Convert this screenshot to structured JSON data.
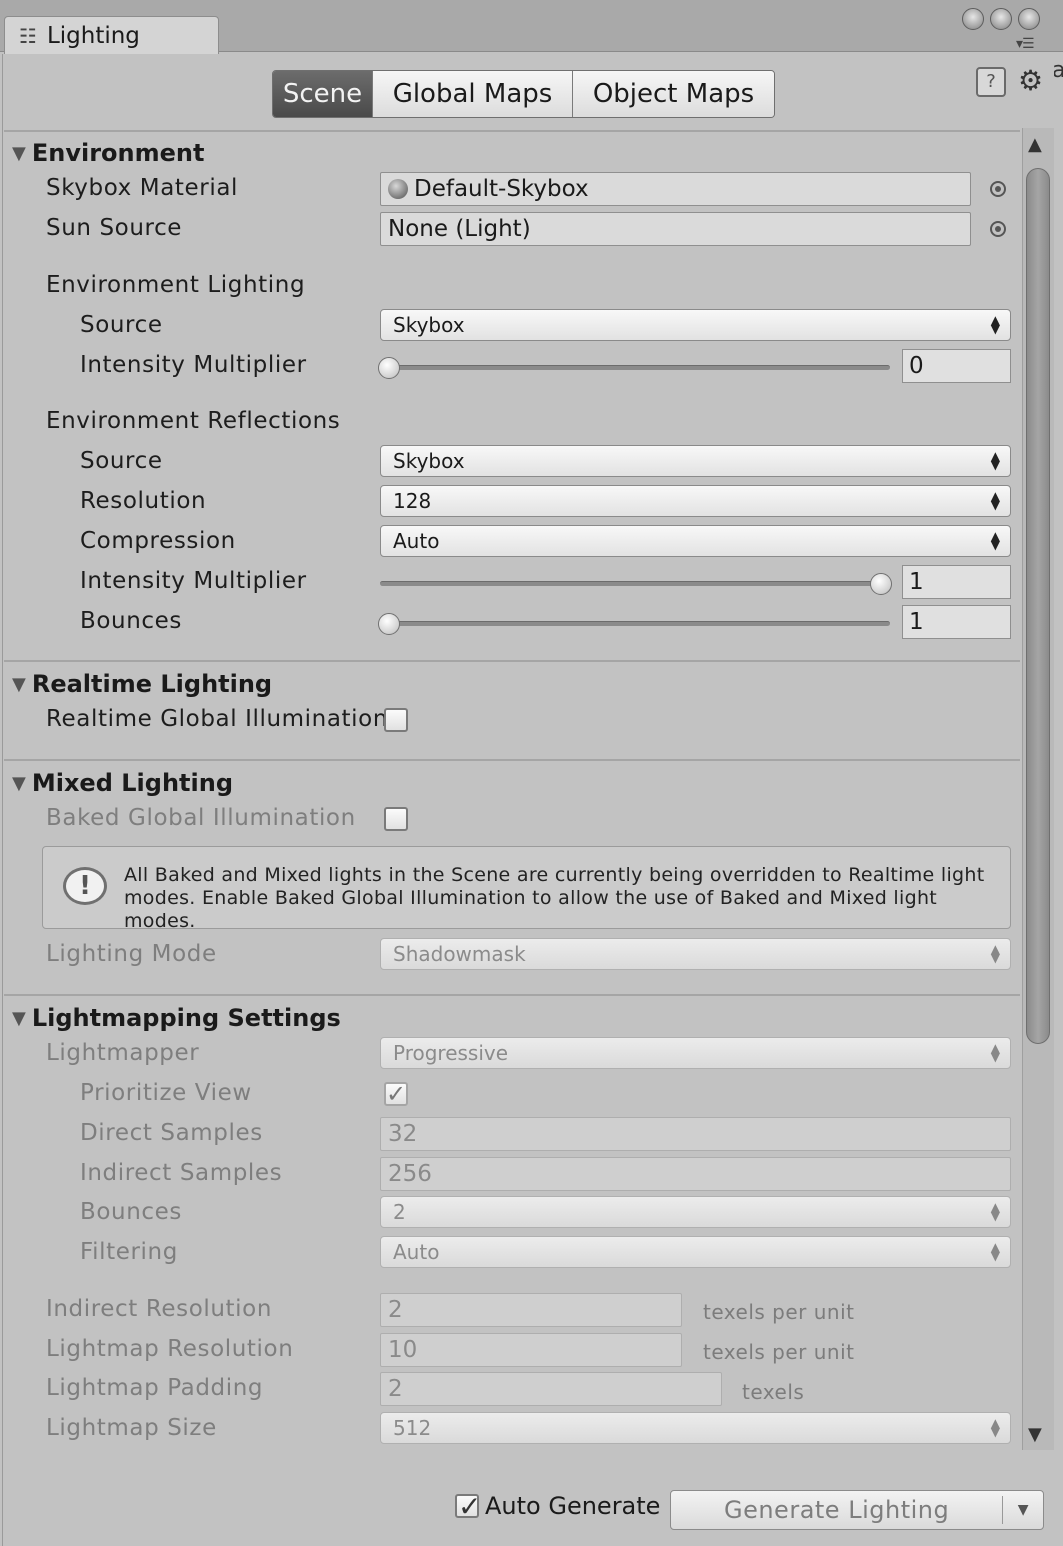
{
  "window": {
    "tab_title": "Lighting",
    "tab_icon": "sliders-icon"
  },
  "tabs": [
    {
      "label": "Scene",
      "active": true
    },
    {
      "label": "Global Maps",
      "active": false
    },
    {
      "label": "Object Maps",
      "active": false
    }
  ],
  "environment": {
    "title": "Environment",
    "skybox_material": {
      "label": "Skybox Material",
      "value": "Default-Skybox"
    },
    "sun_source": {
      "label": "Sun Source",
      "value": "None (Light)"
    },
    "env_lighting": {
      "label": "Environment Lighting",
      "source": {
        "label": "Source",
        "value": "Skybox"
      },
      "intensity": {
        "label": "Intensity Multiplier",
        "value": "0",
        "fraction": 0
      }
    },
    "env_reflections": {
      "label": "Environment Reflections",
      "source": {
        "label": "Source",
        "value": "Skybox"
      },
      "resolution": {
        "label": "Resolution",
        "value": "128"
      },
      "compression": {
        "label": "Compression",
        "value": "Auto"
      },
      "intensity": {
        "label": "Intensity Multiplier",
        "value": "1",
        "fraction": 1
      },
      "bounces": {
        "label": "Bounces",
        "value": "1",
        "fraction": 0
      }
    }
  },
  "realtime": {
    "title": "Realtime Lighting",
    "realtime_gi": {
      "label": "Realtime Global Illumination",
      "checked": false
    }
  },
  "mixed": {
    "title": "Mixed Lighting",
    "baked_gi": {
      "label": "Baked Global Illumination",
      "checked": false
    },
    "help_message": "All Baked and Mixed lights in the Scene are currently being overridden to Realtime light modes. Enable Baked Global Illumination to allow the use of Baked and Mixed light modes.",
    "lighting_mode": {
      "label": "Lighting Mode",
      "value": "Shadowmask"
    }
  },
  "lightmapping": {
    "title": "Lightmapping Settings",
    "lightmapper": {
      "label": "Lightmapper",
      "value": "Progressive"
    },
    "prioritize_view": {
      "label": "Prioritize View",
      "checked": true
    },
    "direct_samples": {
      "label": "Direct Samples",
      "value": "32"
    },
    "indirect_samples": {
      "label": "Indirect Samples",
      "value": "256"
    },
    "bounces": {
      "label": "Bounces",
      "value": "2"
    },
    "filtering": {
      "label": "Filtering",
      "value": "Auto"
    },
    "indirect_resolution": {
      "label": "Indirect Resolution",
      "value": "2",
      "unit": "texels per unit"
    },
    "lightmap_resolution": {
      "label": "Lightmap Resolution",
      "value": "10",
      "unit": "texels per unit"
    },
    "lightmap_padding": {
      "label": "Lightmap Padding",
      "value": "2",
      "unit": "texels"
    },
    "lightmap_size": {
      "label": "Lightmap Size",
      "value": "512"
    }
  },
  "footer": {
    "auto_generate": {
      "label": "Auto Generate",
      "checked": true
    },
    "generate_button": "Generate Lighting"
  },
  "colors": {
    "panel": "#c2c2c2",
    "active_tab": "#5a5a5a",
    "disabled_text": "#7e7e7e"
  }
}
